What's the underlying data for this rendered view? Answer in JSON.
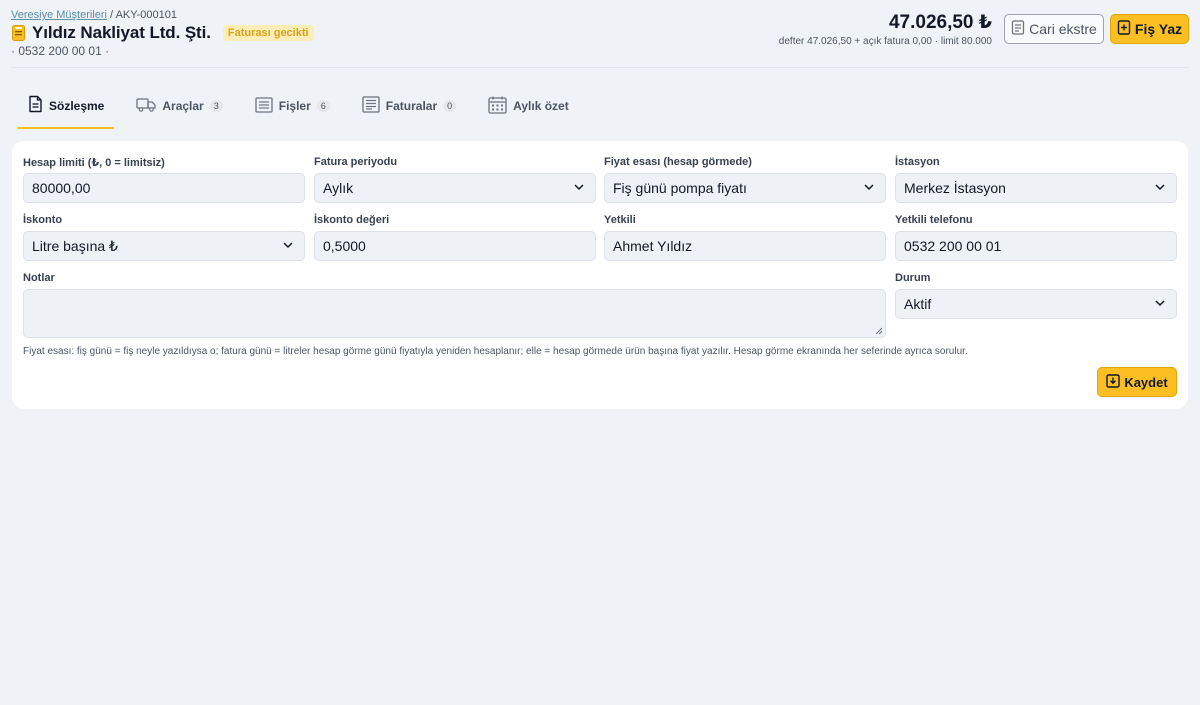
{
  "breadcrumb": {
    "parent": "Veresiye Müşterileri",
    "separator": "/",
    "code": "AKY-000101"
  },
  "customer": {
    "name": "Yıldız Nakliyat Ltd. Şti.",
    "status_badge": "Faturası gecikti",
    "phone_line": "· 0532 200 00 01 ·"
  },
  "totals": {
    "balance": "47.026,50 ₺",
    "summary": "defter 47.026,50 + açık fatura 0,00 · limit 80.000"
  },
  "actions": {
    "statement_label": "Cari ekstre",
    "new_receipt_label": "Fiş Yaz"
  },
  "tabs": [
    {
      "label": "Sözleşme",
      "count": "",
      "icon": "document-icon"
    },
    {
      "label": "Araçlar",
      "count": "3",
      "icon": "truck-icon"
    },
    {
      "label": "Fişler",
      "count": "6",
      "icon": "receipt-icon"
    },
    {
      "label": "Faturalar",
      "count": "0",
      "icon": "invoice-icon"
    },
    {
      "label": "Aylık özet",
      "count": "",
      "icon": "calendar-icon"
    }
  ],
  "form": {
    "credit_limit": {
      "label": "Hesap limiti (₺, 0 = limitsiz)",
      "value": "80000,00"
    },
    "invoice_period": {
      "label": "Fatura periyodu",
      "value": "Aylık"
    },
    "price_basis": {
      "label": "Fiyat esası (hesap görmede)",
      "value": "Fiş günü pompa fiyatı"
    },
    "station": {
      "label": "İstasyon",
      "value": "Merkez İstasyon"
    },
    "discount": {
      "label": "İskonto",
      "value": "Litre başına ₺"
    },
    "discount_value": {
      "label": "İskonto değeri",
      "value": "0,5000"
    },
    "contact": {
      "label": "Yetkili",
      "value": "Ahmet Yıldız"
    },
    "contact_phone": {
      "label": "Yetkili telefonu",
      "value": "0532 200 00 01"
    },
    "notes": {
      "label": "Notlar",
      "value": ""
    },
    "status": {
      "label": "Durum",
      "value": "Aktif"
    },
    "help_text": "Fiyat esası: fiş günü = fiş neyle yazıldıysa o; fatura günü = litreler hesap görme günü fiyatıyla yeniden hesaplanır; elle = hesap görmede ürün başına fiyat yazılır. Hesap görme ekranında her seferinde ayrıca sorulur.",
    "save_label": "Kaydet"
  },
  "colors": {
    "accent": "#fbbf24",
    "badge_bg": "#fdeeb8",
    "badge_text": "#d9a21b",
    "background": "#eff2f7"
  }
}
